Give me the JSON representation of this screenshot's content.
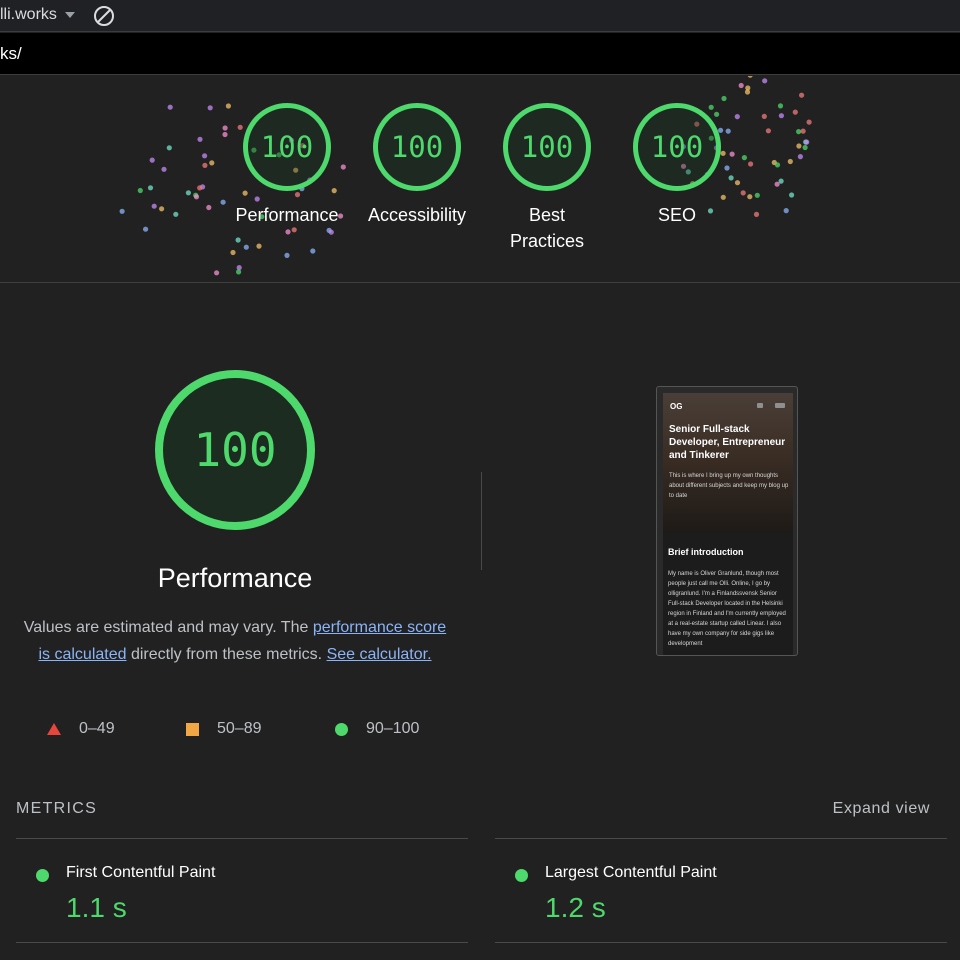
{
  "toolbar": {
    "site": "lli.works",
    "url": "ks/"
  },
  "colors": {
    "pass": "#4dd96b",
    "average": "#f2a745",
    "fail": "#e8453c",
    "link": "#8ab4f8",
    "background": "#212121"
  },
  "icons": [
    "chevron-down-icon",
    "block-icon",
    "triangle-icon",
    "square-icon",
    "circle-icon"
  ],
  "categories": [
    {
      "score": "100",
      "label": "Performance"
    },
    {
      "score": "100",
      "label": "Accessibility"
    },
    {
      "score": "100",
      "label_line1": "Best",
      "label_line2": "Practices"
    },
    {
      "score": "100",
      "label": "SEO"
    }
  ],
  "performance": {
    "score": "100",
    "title": "Performance",
    "desc_start": "Values are estimated and may vary. The ",
    "desc_link1": "performance score is calculated",
    "desc_middle": " directly from these metrics. ",
    "desc_link2": "See calculator."
  },
  "legend": [
    {
      "range": "0–49"
    },
    {
      "range": "50–89"
    },
    {
      "range": "90–100"
    }
  ],
  "screenshot": {
    "logo": "OG",
    "headline": "Senior Full-stack Developer, Entrepreneur and Tinkerer",
    "intro": "This is where I bring up my own thoughts about different subjects and keep my blog up to date",
    "section_title": "Brief introduction",
    "section_text": "My name is Oliver Granlund, though most people just call me Olli. Online, I go by olligranlund. I'm a Finlandssvensk Senior Full-stack Developer located in the Helsinki region in Finland and I'm currently employed at a real-estate startup called Linear. I also have my own company for side gigs like development"
  },
  "metrics": {
    "heading": "METRICS",
    "expand": "Expand view",
    "items": [
      {
        "name": "First Contentful Paint",
        "value": "1.1 s"
      },
      {
        "name": "Largest Contentful Paint",
        "value": "1.2 s"
      }
    ]
  }
}
